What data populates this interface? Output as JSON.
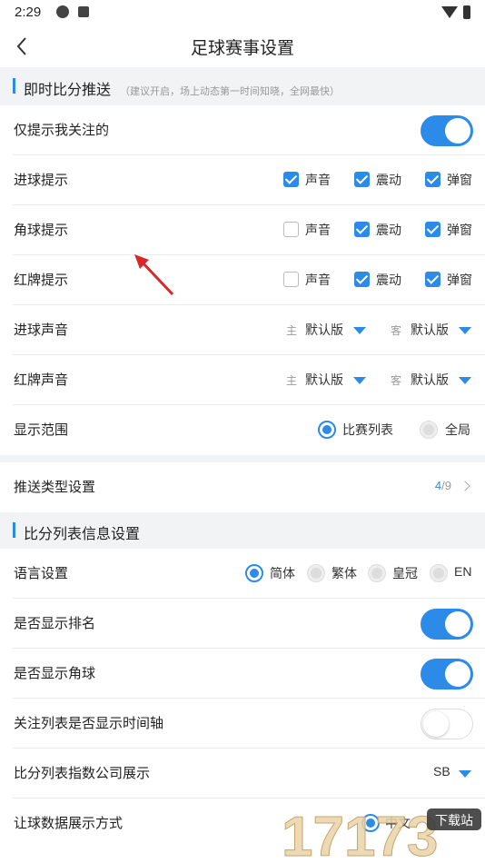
{
  "status": {
    "time": "2:29",
    "icons": [
      "sync-icon",
      "a-badge-icon",
      "wifi-icon",
      "battery-icon"
    ]
  },
  "nav": {
    "title": "足球赛事设置",
    "back_icon": "chevron-left-icon"
  },
  "accent": "#2c8be8",
  "push_section": {
    "title": "即时比分推送",
    "note": "（建议开启，场上动态第一时间知晓，全网最快）"
  },
  "rows": {
    "only_followed": {
      "label": "仅提示我关注的",
      "on": true
    },
    "goal_alert": {
      "label": "进球提示",
      "options": [
        {
          "label": "声音",
          "checked": true
        },
        {
          "label": "震动",
          "checked": true
        },
        {
          "label": "弹窗",
          "checked": true
        }
      ]
    },
    "corner_alert": {
      "label": "角球提示",
      "options": [
        {
          "label": "声音",
          "checked": false
        },
        {
          "label": "震动",
          "checked": true
        },
        {
          "label": "弹窗",
          "checked": true
        }
      ]
    },
    "red_card_alert": {
      "label": "红牌提示",
      "options": [
        {
          "label": "声音",
          "checked": false
        },
        {
          "label": "震动",
          "checked": true
        },
        {
          "label": "弹窗",
          "checked": true
        }
      ]
    },
    "goal_sound": {
      "label": "进球声音",
      "home_tag": "主",
      "home_value": "默认版",
      "away_tag": "客",
      "away_value": "默认版"
    },
    "red_card_sound": {
      "label": "红牌声音",
      "home_tag": "主",
      "home_value": "默认版",
      "away_tag": "客",
      "away_value": "默认版"
    },
    "display_scope": {
      "label": "显示范围",
      "options": [
        {
          "label": "比赛列表",
          "selected": true
        },
        {
          "label": "全局",
          "selected": false
        }
      ]
    }
  },
  "push_type": {
    "label": "推送类型设置",
    "current": "4",
    "total": "/9"
  },
  "list_section": {
    "title": "比分列表信息设置"
  },
  "list_rows": {
    "language": {
      "label": "语言设置",
      "options": [
        {
          "label": "简体",
          "selected": true
        },
        {
          "label": "繁体",
          "selected": false
        },
        {
          "label": "皇冠",
          "selected": false
        },
        {
          "label": "EN",
          "selected": false
        }
      ]
    },
    "show_rank": {
      "label": "是否显示排名",
      "on": true
    },
    "show_corner": {
      "label": "是否显示角球",
      "on": true
    },
    "timeline": {
      "label": "关注列表是否显示时间轴",
      "on": false
    },
    "index_company": {
      "label": "比分列表指数公司展示",
      "value": "SB"
    },
    "handicap_display": {
      "label": "让球数据展示方式",
      "option_label": "中文"
    }
  },
  "watermark": {
    "text": "17173",
    "badge": "下载站"
  }
}
